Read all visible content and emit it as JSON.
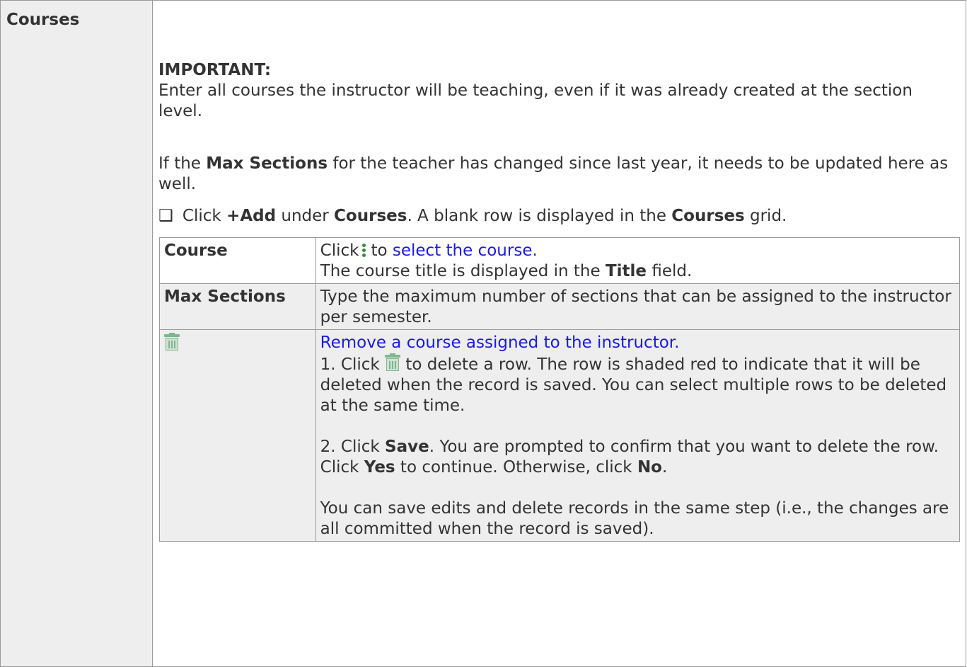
{
  "section_label": "Courses",
  "important_heading": "IMPORTANT:",
  "enter_text": "Enter all courses the instructor will be teaching, even if it was already created at the section level.",
  "max_para": {
    "pre": "If the ",
    "bold": "Max Sections",
    "post": " for the teacher has changed since last year, it needs to be updated here as well."
  },
  "click_line": {
    "checkbox": "❑",
    "pre": " Click ",
    "add": "+Add",
    "mid1": " under ",
    "courses1": "Courses",
    "mid2": ". A blank row is displayed in the ",
    "courses2": "Courses",
    "post": " grid."
  },
  "grid": {
    "course": {
      "label": "Course",
      "click": "Click",
      "to": "to ",
      "link": "select the course",
      "period": ".",
      "line2_pre": "The course title is displayed in the ",
      "line2_bold": "Title",
      "line2_post": " field."
    },
    "max_sections": {
      "label": "Max Sections",
      "text": "Type the maximum number of sections that can be assigned to the instructor per semester."
    },
    "delete": {
      "icon": "trash-icon",
      "link": "Remove a course assigned to the instructor.",
      "step1_pre": "1. Click",
      "step1_post": "to delete a row. The row is shaded red to indicate that it will be deleted when the record is saved. You can select multiple rows to be deleted at the same time.",
      "step2_pre": "2. Click ",
      "step2_save": "Save",
      "step2_mid": ". You are prompted to confirm that you want to delete the row. Click ",
      "step2_yes": "Yes",
      "step2_mid2": " to continue. Otherwise, click ",
      "step2_no": "No",
      "step2_end": ".",
      "note": "You can save edits and delete records in the same step (i.e., the changes are all committed when the record is saved)."
    }
  },
  "colors": {
    "text": "#333333",
    "link": "#1a1ae6",
    "shade": "#eeeeee",
    "border": "#9a9a9a",
    "icon_green": "#7fb58f"
  }
}
